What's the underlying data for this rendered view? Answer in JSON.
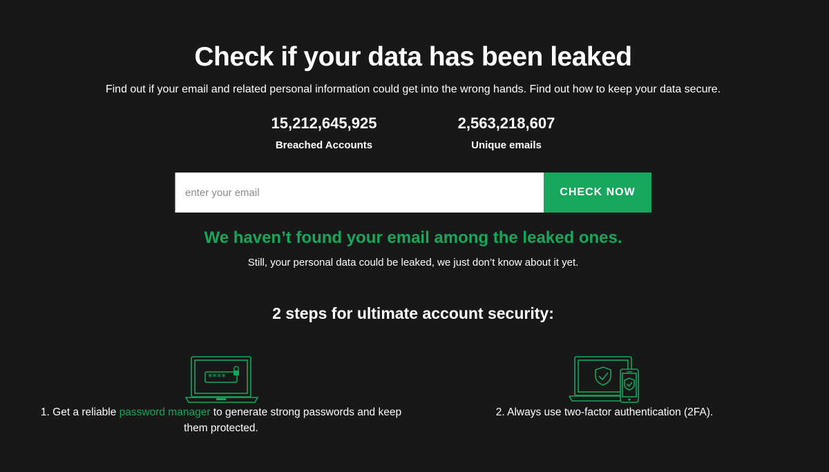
{
  "hero": {
    "title": "Check if your data has been leaked",
    "subtitle": "Find out if your email and related personal information could get into the wrong hands. Find out how to keep your data secure."
  },
  "stats": [
    {
      "number": "15,212,645,925",
      "label": "Breached Accounts"
    },
    {
      "number": "2,563,218,607",
      "label": "Unique emails"
    }
  ],
  "form": {
    "email_placeholder": "enter your email",
    "email_value": "",
    "button_label": "CHECK NOW"
  },
  "result": {
    "title": "We haven’t found your email among the leaked ones.",
    "subtitle": "Still, your personal data could be leaked, we just don’t know about it yet."
  },
  "steps": {
    "title": "2 steps for ultimate account security:",
    "step1": {
      "prefix": "1. Get a reliable ",
      "link": "password manager",
      "suffix": " to generate strong passwords and keep them protected.",
      "icon": "laptop-password-icon"
    },
    "step2": {
      "text": "2. Always use two-factor authentication (2FA).",
      "icon": "laptop-phone-shield-icon"
    }
  },
  "colors": {
    "background": "#181818",
    "accent": "#16a75c",
    "text": "#ffffff"
  }
}
